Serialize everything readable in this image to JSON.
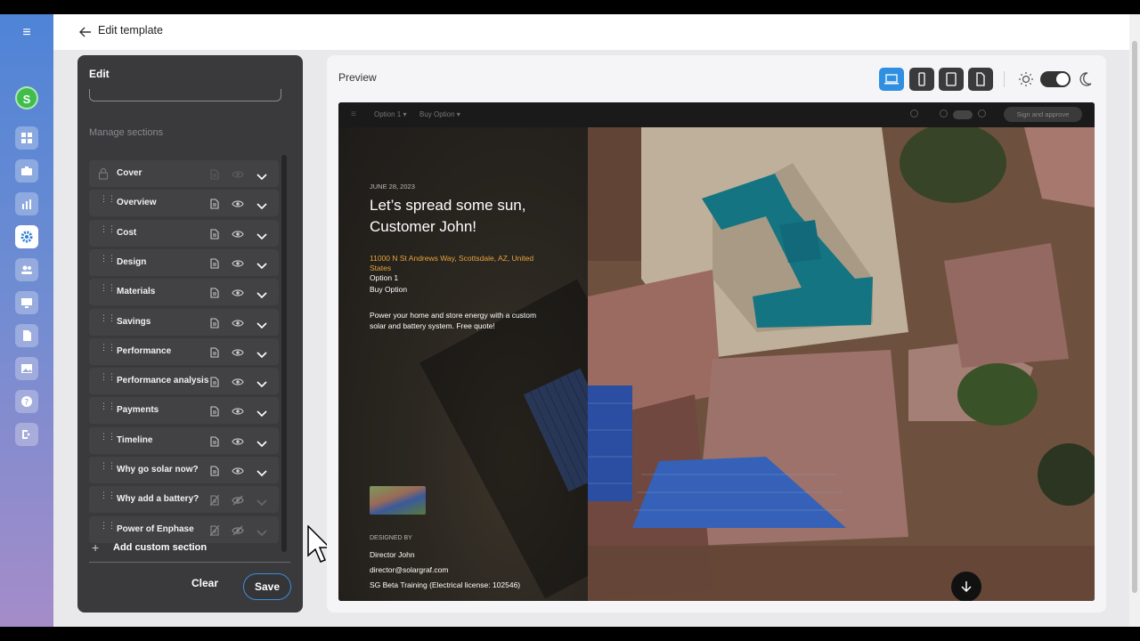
{
  "rail": {
    "avatar_letter": "S",
    "icons": [
      "menu-icon",
      "dashboard-icon",
      "briefcase-icon",
      "chart-icon",
      "gear-icon",
      "users-icon",
      "monitor-icon",
      "document-icon",
      "image-icon",
      "help-icon",
      "logout-icon"
    ],
    "active": "gear-icon",
    "colors": {
      "top": "#4f84d6",
      "bottom": "#a58cc9",
      "avatar": "#3fbe4c"
    }
  },
  "header": {
    "title": "Edit template"
  },
  "edit": {
    "title": "Edit",
    "manage_label": "Manage sections",
    "sections": [
      {
        "label": "Cover",
        "locked": true,
        "visible": true,
        "enabled": false
      },
      {
        "label": "Overview",
        "locked": false,
        "visible": true,
        "enabled": true
      },
      {
        "label": "Cost",
        "locked": false,
        "visible": true,
        "enabled": true
      },
      {
        "label": "Design",
        "locked": false,
        "visible": true,
        "enabled": true
      },
      {
        "label": "Materials",
        "locked": false,
        "visible": true,
        "enabled": true
      },
      {
        "label": "Savings",
        "locked": false,
        "visible": true,
        "enabled": true
      },
      {
        "label": "Performance",
        "locked": false,
        "visible": true,
        "enabled": true
      },
      {
        "label": "Performance analysis",
        "locked": false,
        "visible": true,
        "enabled": true
      },
      {
        "label": "Payments",
        "locked": false,
        "visible": true,
        "enabled": true
      },
      {
        "label": "Timeline",
        "locked": false,
        "visible": true,
        "enabled": true
      },
      {
        "label": "Why go solar now?",
        "locked": false,
        "visible": true,
        "enabled": true
      },
      {
        "label": "Why add a battery?",
        "locked": false,
        "visible": false,
        "enabled": false
      },
      {
        "label": "Power of Enphase",
        "locked": false,
        "visible": false,
        "enabled": false
      }
    ],
    "add_label": "Add custom section",
    "clear_label": "Clear",
    "save_label": "Save"
  },
  "preview": {
    "title": "Preview",
    "devices": [
      "laptop-icon",
      "phone-icon",
      "tablet-icon",
      "document-icon"
    ],
    "active_device": "laptop-icon",
    "dark_mode": true,
    "frame": {
      "option_label": "Option 1",
      "buy_label": "Buy Option",
      "sign_label": "Sign and approve",
      "date": "JUNE 28, 2023",
      "headline": "Let’s spread some sun, Customer John!",
      "address": "11000 N St Andrews Way, Scottsdale, AZ, United States",
      "option": "Option 1",
      "buy": "Buy Option",
      "pitch": "Power your home and store energy with a custom solar and battery system. Free quote!",
      "designed_by_label": "DESIGNED BY",
      "designer_name": "Director John",
      "designer_email": "director@solargraf.com",
      "designer_license": "SG Beta Training (Electrical license: 102546)"
    },
    "colors": {
      "accent": "#2f8fe0",
      "address": "#e8a33a"
    }
  }
}
